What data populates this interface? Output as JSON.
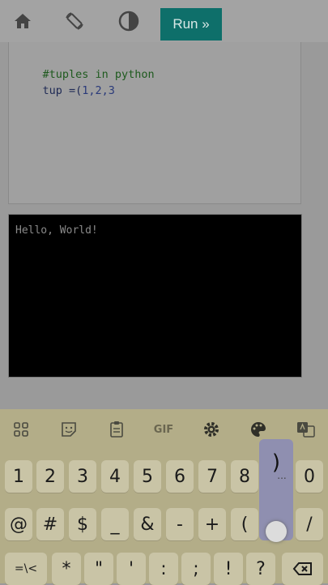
{
  "toolbar": {
    "run_label": "Run »",
    "icons": [
      "home-icon",
      "rotate-icon",
      "contrast-icon"
    ]
  },
  "editor": {
    "lines": [
      {
        "comment": "#tuples in python"
      },
      {
        "code": "tup =(",
        "nums": "1,2,3"
      }
    ]
  },
  "console": {
    "output": "Hello, World!"
  },
  "keyboard": {
    "tools": [
      "apps-icon",
      "sticker-icon",
      "clipboard-icon",
      "gif-icon",
      "gear-icon",
      "palette-icon",
      "translate-icon"
    ],
    "gif_label": "GIF",
    "row1": [
      "1",
      "2",
      "3",
      "4",
      "5",
      "6",
      "7",
      "8",
      "",
      "0"
    ],
    "row2": [
      "@",
      "#",
      "$",
      "_",
      "&",
      "-",
      "+",
      "(",
      "",
      "/"
    ],
    "row3": [
      "=\\<",
      "*",
      "\"",
      "'",
      ":",
      ";",
      "!",
      "?"
    ],
    "popup_char": ")",
    "popup_dots": "..."
  }
}
